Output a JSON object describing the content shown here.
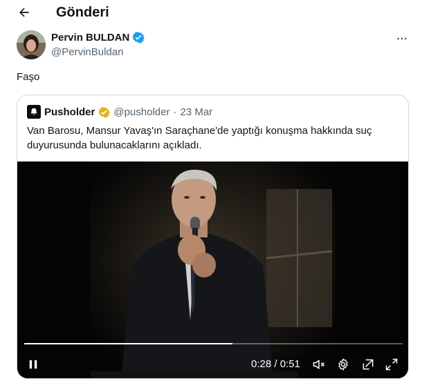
{
  "header": {
    "title": "Gönderi",
    "back_icon": "arrow-left-icon"
  },
  "tweet": {
    "author_name": "Pervin BULDAN",
    "author_handle": "@PervinBuldan",
    "verified_color": "#1d9bf0",
    "text": "Faşo"
  },
  "quote": {
    "author_name": "Pusholder",
    "author_handle": "@pusholder",
    "separator": "·",
    "date": "23 Mar",
    "verified_color": "#e2b719",
    "text": "Van Barosu, Mansur Yavaş'ın Saraçhane'de yaptığı konuşma hakkında suç duyurusunda bulunacaklarını açıkladı.",
    "video": {
      "time_display": "0:28 / 0:51",
      "progress": 0.55
    }
  }
}
